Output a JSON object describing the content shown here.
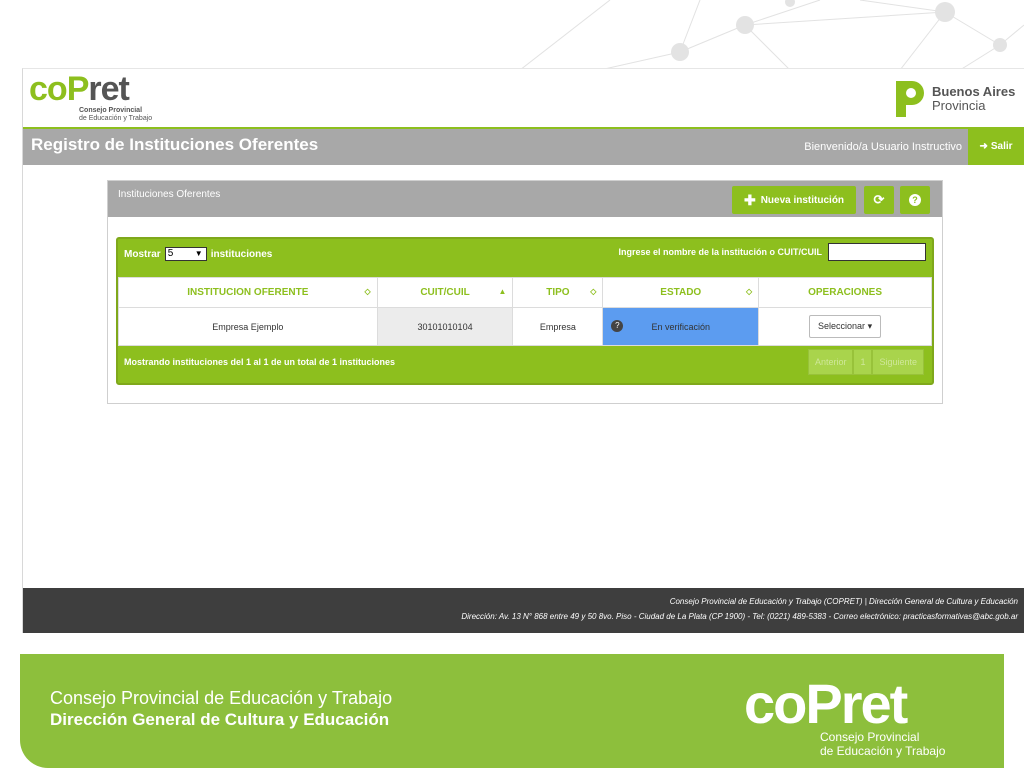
{
  "header": {
    "logo": {
      "word": "coPret",
      "sub1": "Consejo Provincial",
      "sub2": "de Educación y Trabajo"
    },
    "province_logo": {
      "line1": "Buenos Aires",
      "line2": "Provincia"
    }
  },
  "titlebar": {
    "title": "Registro de Instituciones Oferentes",
    "welcome": "Bienvenido/a Usuario Instructivo",
    "logout_label": "Salir"
  },
  "panel": {
    "title": "Instituciones Oferentes",
    "new_button_label": "Nueva institución",
    "refresh_icon": "refresh-icon",
    "help_icon": "help-icon"
  },
  "grid": {
    "show_label": "Mostrar",
    "page_size": "5",
    "show_suffix": "instituciones",
    "search_label": "Ingrese el nombre de la institución o CUIT/CUIL",
    "search_value": "",
    "columns": [
      "INSTITUCION OFERENTE",
      "CUIT/CUIL",
      "TIPO",
      "ESTADO",
      "OPERACIONES"
    ],
    "rows": [
      {
        "institucion": "Empresa Ejemplo",
        "cuit": "30101010104",
        "tipo": "Empresa",
        "estado": "En verificación",
        "operacion": "Seleccionar"
      }
    ],
    "footer_info": "Mostrando instituciones del 1 al 1 de un total de 1 instituciones",
    "pager": {
      "prev": "Anterior",
      "page": "1",
      "next": "Siguiente"
    }
  },
  "footer": {
    "line1": "Consejo Provincial de Educación y Trabajo (COPRET) | Dirección General de Cultura y Educación",
    "line2": "Dirección: Av. 13 N° 868 entre 49 y 50 8vo. Piso - Ciudad de La Plata (CP 1900) - Tel: (0221) 489-5383 - Correo electrónico: practicasformativas@abc.gob.ar"
  },
  "banner": {
    "line1": "Consejo Provincial de Educación y Trabajo",
    "line2": "Dirección General de Cultura y Educación",
    "logo_word": "coPret",
    "logo_sub1": "Consejo Provincial",
    "logo_sub2": "de Educación y Trabajo"
  },
  "colors": {
    "accent": "#8dbf1e",
    "gray_bar": "#a8a8a8",
    "estado_bg": "#5c9cf0",
    "dark_footer": "#3e3e3e"
  }
}
